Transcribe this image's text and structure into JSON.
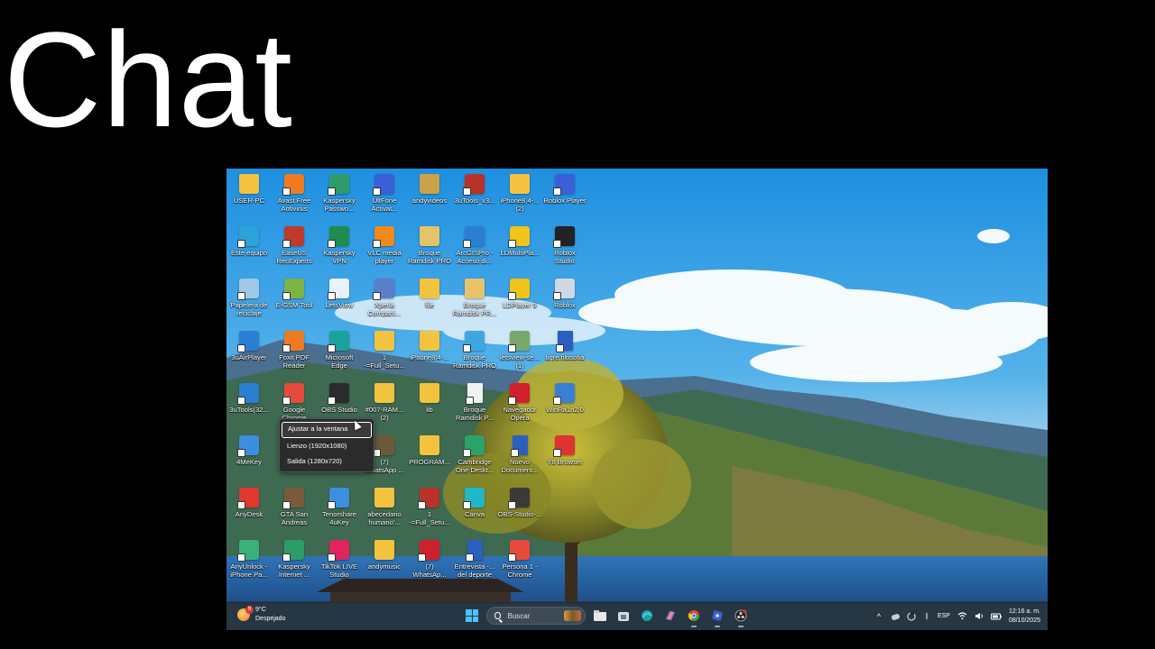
{
  "overlay_title": "Chat",
  "desktop": {
    "icons": [
      {
        "label": "USER-PC",
        "col": 0,
        "row": 0,
        "kind": "folder",
        "color": "#f3c33f"
      },
      {
        "label": "Avast Free\nAntivirus",
        "col": 1,
        "row": 0,
        "kind": "app",
        "color": "#f07a22"
      },
      {
        "label": "Kaspersky\nPasswo...",
        "col": 2,
        "row": 0,
        "kind": "app",
        "color": "#2e9c6a"
      },
      {
        "label": "UltFone\nActivat...",
        "col": 3,
        "row": 0,
        "kind": "app",
        "color": "#3b5fd6"
      },
      {
        "label": "andyvideos",
        "col": 4,
        "row": 0,
        "kind": "folder",
        "color": "#caa24a"
      },
      {
        "label": "3uTools_v3...",
        "col": 5,
        "row": 0,
        "kind": "app",
        "color": "#b8322a"
      },
      {
        "label": "iPhone8,4-...\n(2)",
        "col": 6,
        "row": 0,
        "kind": "folder",
        "color": "#f3c33f"
      },
      {
        "label": "Roblox Player",
        "col": 7,
        "row": 0,
        "kind": "app",
        "color": "#3b5fd6"
      },
      {
        "label": "Este equipo",
        "col": 0,
        "row": 1,
        "kind": "app",
        "color": "#2aa3d8"
      },
      {
        "label": "EaseUS\nRecExperts",
        "col": 1,
        "row": 1,
        "kind": "app",
        "color": "#c0392b"
      },
      {
        "label": "Kaspersky\nVPN",
        "col": 2,
        "row": 1,
        "kind": "app",
        "color": "#1e8c4e"
      },
      {
        "label": "VLC media\nplayer",
        "col": 3,
        "row": 1,
        "kind": "app",
        "color": "#f08a1c"
      },
      {
        "label": "Broque\nRamdisk PRO",
        "col": 4,
        "row": 1,
        "kind": "folder",
        "color": "#e6c36a"
      },
      {
        "label": "ArcGISPro -\nAcceso di...",
        "col": 5,
        "row": 1,
        "kind": "app",
        "color": "#2a7fd4"
      },
      {
        "label": "LDMultiPla...",
        "col": 6,
        "row": 1,
        "kind": "app",
        "color": "#f0c419"
      },
      {
        "label": "Roblox\nStudio",
        "col": 7,
        "row": 1,
        "kind": "app",
        "color": "#222"
      },
      {
        "label": "Papelera de\nreciclaje",
        "col": 0,
        "row": 2,
        "kind": "app",
        "color": "#9fc9e6"
      },
      {
        "label": "E-GSM Tool",
        "col": 1,
        "row": 2,
        "kind": "app",
        "color": "#7cb342"
      },
      {
        "label": "LetsView",
        "col": 2,
        "row": 2,
        "kind": "app",
        "color": "#e8f2ff"
      },
      {
        "label": "Xperia\nCompani...",
        "col": 3,
        "row": 2,
        "kind": "app",
        "color": "#5a7ec8"
      },
      {
        "label": "file",
        "col": 4,
        "row": 2,
        "kind": "folder",
        "color": "#f3c33f"
      },
      {
        "label": "Broque\nRamdisk PR...",
        "col": 5,
        "row": 2,
        "kind": "folder",
        "color": "#e6c36a"
      },
      {
        "label": "LDPlayer 9",
        "col": 6,
        "row": 2,
        "kind": "app",
        "color": "#f0c419"
      },
      {
        "label": "Roblox",
        "col": 7,
        "row": 2,
        "kind": "app",
        "color": "#cfd8e3"
      },
      {
        "label": "3uAirPlayer",
        "col": 0,
        "row": 3,
        "kind": "app",
        "color": "#2a7fd4"
      },
      {
        "label": "Foxit PDF\nReader",
        "col": 1,
        "row": 3,
        "kind": "app",
        "color": "#f07a22"
      },
      {
        "label": "Microsoft\nEdge",
        "col": 2,
        "row": 3,
        "kind": "app",
        "color": "#1aa39a"
      },
      {
        "label": "1\n-=Full_Setu...",
        "col": 3,
        "row": 3,
        "kind": "folder",
        "color": "#f3c33f"
      },
      {
        "label": "iPhone8,4-...",
        "col": 4,
        "row": 3,
        "kind": "folder",
        "color": "#f3c33f"
      },
      {
        "label": "Broque\nRamdisk PRO",
        "col": 5,
        "row": 3,
        "kind": "app",
        "color": "#3fa7e0"
      },
      {
        "label": "letsview-se...\n(1)",
        "col": 6,
        "row": 3,
        "kind": "app",
        "color": "#7aa86a"
      },
      {
        "label": "tigre.filosofia",
        "col": 7,
        "row": 3,
        "kind": "doc",
        "color": "#2b5fbf"
      },
      {
        "label": "3uTools(32...",
        "col": 0,
        "row": 4,
        "kind": "app",
        "color": "#2a7fd4"
      },
      {
        "label": "Google\nChrome",
        "col": 1,
        "row": 4,
        "kind": "app",
        "color": "#e64a3b"
      },
      {
        "label": "OBS Studio",
        "col": 2,
        "row": 4,
        "kind": "app",
        "color": "#2b2b2b"
      },
      {
        "label": "#007-RAM...\n(2)",
        "col": 3,
        "row": 4,
        "kind": "folder",
        "color": "#f3c33f"
      },
      {
        "label": "lib",
        "col": 4,
        "row": 4,
        "kind": "folder",
        "color": "#f3c33f"
      },
      {
        "label": "Broque\nRamdisk P...",
        "col": 5,
        "row": 4,
        "kind": "doc",
        "color": "#f2f2f2"
      },
      {
        "label": "Navegador\nOpera",
        "col": 6,
        "row": 4,
        "kind": "app",
        "color": "#d0202d"
      },
      {
        "label": "WinRa1n2.0",
        "col": 7,
        "row": 4,
        "kind": "app",
        "color": "#3a7fd6"
      },
      {
        "label": "4MeKey",
        "col": 0,
        "row": 5,
        "kind": "app",
        "color": "#3b8fe0"
      },
      {
        "label": "(7)\nWhatsApp ...",
        "col": 3,
        "row": 5,
        "kind": "app",
        "color": "#6b5a3a"
      },
      {
        "label": "PROGRAM...",
        "col": 4,
        "row": 5,
        "kind": "folder",
        "color": "#f3c33f"
      },
      {
        "label": "Cambridge\nOne Deskt...",
        "col": 5,
        "row": 5,
        "kind": "app",
        "color": "#2aa36a"
      },
      {
        "label": "Nuevo\nDocument...",
        "col": 6,
        "row": 5,
        "kind": "doc",
        "color": "#2b5fbf"
      },
      {
        "label": "Y8 Browser",
        "col": 7,
        "row": 5,
        "kind": "app",
        "color": "#d33"
      },
      {
        "label": "AnyDesk",
        "col": 0,
        "row": 6,
        "kind": "app",
        "color": "#e2372c"
      },
      {
        "label": "GTA San\nAndreas",
        "col": 1,
        "row": 6,
        "kind": "app",
        "color": "#7a5a3a"
      },
      {
        "label": "Tenorshare\n4uKey",
        "col": 2,
        "row": 6,
        "kind": "app",
        "color": "#3a8fe0"
      },
      {
        "label": "abecedario\nhumano'...",
        "col": 3,
        "row": 6,
        "kind": "folder",
        "color": "#f3c33f"
      },
      {
        "label": "1\n-=Full_Setu...",
        "col": 4,
        "row": 6,
        "kind": "app",
        "color": "#b8322a"
      },
      {
        "label": "Canva",
        "col": 5,
        "row": 6,
        "kind": "app",
        "color": "#1fb8c9"
      },
      {
        "label": "OBS-Studio-...",
        "col": 6,
        "row": 6,
        "kind": "app",
        "color": "#3a3a3a"
      },
      {
        "label": "AnyUnlock -\niPhone Pa...",
        "col": 0,
        "row": 7,
        "kind": "app",
        "color": "#3ab07a"
      },
      {
        "label": "Kaspersky\nInternet ...",
        "col": 1,
        "row": 7,
        "kind": "app",
        "color": "#2e9c6a"
      },
      {
        "label": "TikTok LIVE\nStudio",
        "col": 2,
        "row": 7,
        "kind": "app",
        "color": "#e0245e"
      },
      {
        "label": "andymusic",
        "col": 3,
        "row": 7,
        "kind": "folder",
        "color": "#f3c33f"
      },
      {
        "label": "(7)\nWhatsAp...",
        "col": 4,
        "row": 7,
        "kind": "app",
        "color": "#d0202d"
      },
      {
        "label": "Entrevista -...\ndel deporte",
        "col": 5,
        "row": 7,
        "kind": "doc",
        "color": "#2b5fbf"
      },
      {
        "label": "Persona 1 -\nChrome",
        "col": 6,
        "row": 7,
        "kind": "app",
        "color": "#e64a3b"
      }
    ],
    "context_menu": {
      "items": [
        "Ajustar a la ventana",
        "Lienzo (1920x1080)",
        "Salida (1280x720)"
      ],
      "selected": 0
    }
  },
  "taskbar": {
    "weather": {
      "badge": "9",
      "temp": "9°C",
      "condition": "Despejado"
    },
    "search_placeholder": "Buscar",
    "apps": [
      "file-explorer-icon",
      "store-icon",
      "edge-icon",
      "copilot-icon",
      "chrome-icon",
      "roblox-icon",
      "obs-icon"
    ],
    "tray": {
      "chevron": "^",
      "language": "ESP",
      "time": "12:16 a. m.",
      "date": "08/10/2025"
    }
  },
  "colors": {
    "taskbar_bg": "#1c2834",
    "accent": "#4cc2ff",
    "title": "#ffffff"
  }
}
